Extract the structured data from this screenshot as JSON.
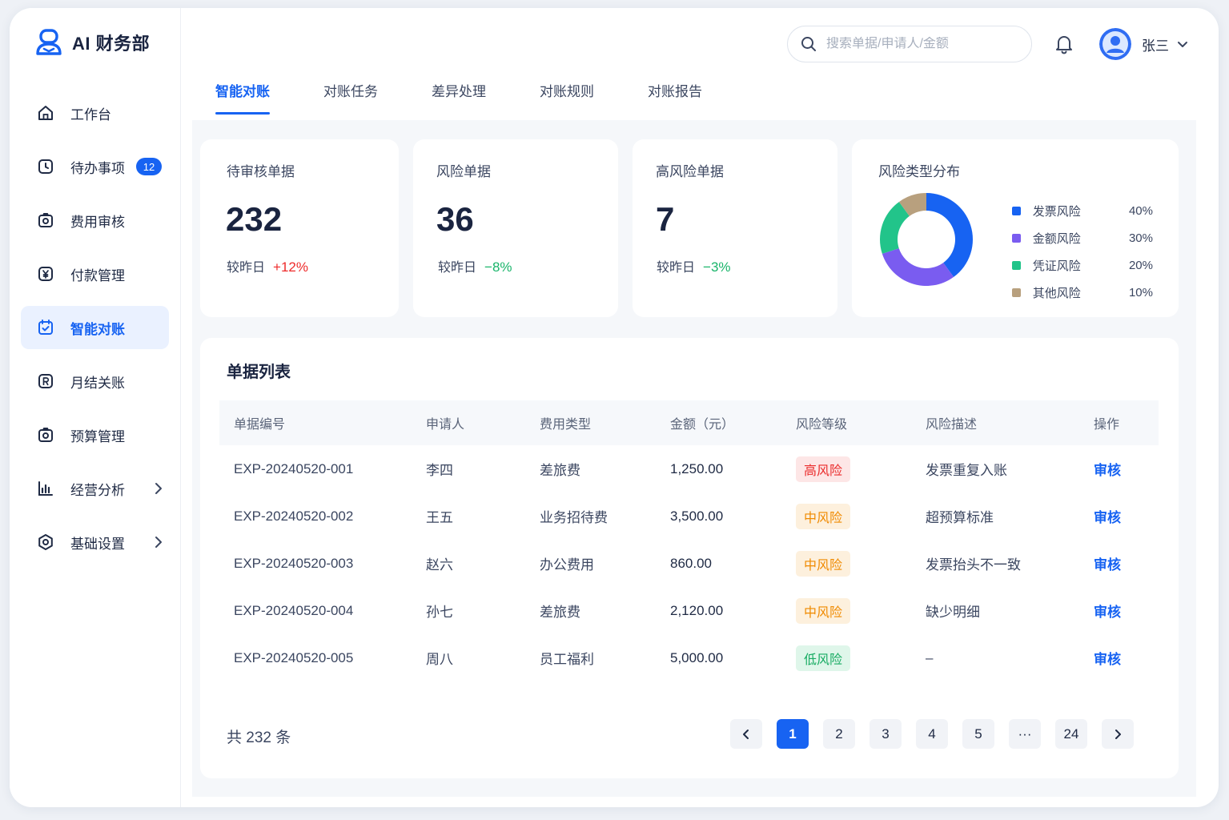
{
  "app": {
    "title": "AI 财务部"
  },
  "sidebar": {
    "items": [
      {
        "label": "工作台",
        "icon": "home-icon"
      },
      {
        "label": "待办事项",
        "icon": "clock-icon",
        "badge": "12"
      },
      {
        "label": "费用审核",
        "icon": "camera-icon"
      },
      {
        "label": "付款管理",
        "icon": "yen-icon"
      },
      {
        "label": "智能对账",
        "icon": "calendar-check-icon",
        "active": true
      },
      {
        "label": "月结关账",
        "icon": "r-square-icon"
      },
      {
        "label": "预算管理",
        "icon": "camera-icon"
      },
      {
        "label": "经营分析",
        "icon": "bar-chart-icon",
        "expandable": true
      },
      {
        "label": "基础设置",
        "icon": "settings-icon",
        "expandable": true
      }
    ]
  },
  "header": {
    "search_placeholder": "搜索单据/申请人/金额",
    "user_name": "张三"
  },
  "tabs": [
    {
      "label": "智能对账",
      "active": true
    },
    {
      "label": "对账任务"
    },
    {
      "label": "差异处理"
    },
    {
      "label": "对账规则"
    },
    {
      "label": "对账报告"
    }
  ],
  "stats": [
    {
      "title": "待审核单据",
      "value": "232",
      "compare_label": "较昨日",
      "delta": "+12%",
      "trend": "up"
    },
    {
      "title": "风险单据",
      "value": "36",
      "compare_label": "较昨日",
      "delta": "−8%",
      "trend": "down"
    },
    {
      "title": "高风险单据",
      "value": "7",
      "compare_label": "较昨日",
      "delta": "−3%",
      "trend": "down"
    }
  ],
  "distribution": {
    "title": "风险类型分布",
    "items": [
      {
        "name": "发票风险",
        "value": 40,
        "label": "40%",
        "color": "#1763f2"
      },
      {
        "name": "金额风险",
        "value": 30,
        "label": "30%",
        "color": "#7a5cf0"
      },
      {
        "name": "凭证风险",
        "value": 20,
        "label": "20%",
        "color": "#22c48a"
      },
      {
        "name": "其他风险",
        "value": 10,
        "label": "10%",
        "color": "#b8a07e"
      }
    ]
  },
  "table": {
    "title": "单据列表",
    "columns": [
      "单据编号",
      "申请人",
      "费用类型",
      "金额（元）",
      "风险等级",
      "风险描述",
      "操作"
    ],
    "rows": [
      {
        "id": "EXP-20240520-001",
        "applicant": "李四",
        "type": "差旅费",
        "amount": "1,250.00",
        "risk": "高风险",
        "level": "high",
        "desc": "发票重复入账",
        "action": "审核"
      },
      {
        "id": "EXP-20240520-002",
        "applicant": "王五",
        "type": "业务招待费",
        "amount": "3,500.00",
        "risk": "中风险",
        "level": "mid",
        "desc": "超预算标准",
        "action": "审核"
      },
      {
        "id": "EXP-20240520-003",
        "applicant": "赵六",
        "type": "办公费用",
        "amount": "860.00",
        "risk": "中风险",
        "level": "mid",
        "desc": "发票抬头不一致",
        "action": "审核"
      },
      {
        "id": "EXP-20240520-004",
        "applicant": "孙七",
        "type": "差旅费",
        "amount": "2,120.00",
        "risk": "中风险",
        "level": "mid",
        "desc": "缺少明细",
        "action": "审核"
      },
      {
        "id": "EXP-20240520-005",
        "applicant": "周八",
        "type": "员工福利",
        "amount": "5,000.00",
        "risk": "低风险",
        "level": "low",
        "desc": "–",
        "action": "审核"
      }
    ],
    "total": "共 232 条"
  },
  "pagination": {
    "pages": [
      "1",
      "2",
      "3",
      "4",
      "5",
      "···",
      "24"
    ],
    "current": "1"
  }
}
